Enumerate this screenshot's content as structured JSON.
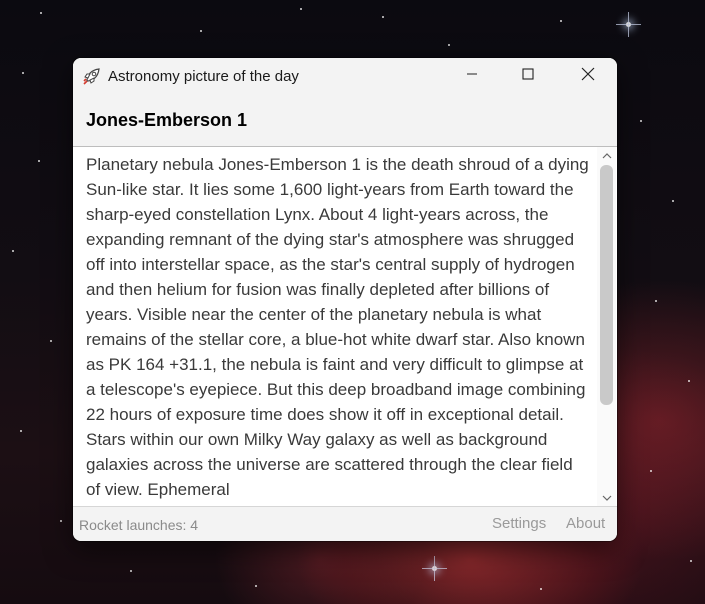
{
  "window": {
    "title": "Astronomy picture of the day",
    "app_icon": "rocket-icon",
    "controls": {
      "minimize_icon": "minimize-icon",
      "maximize_icon": "maximize-icon",
      "close_icon": "close-icon"
    }
  },
  "article": {
    "title": "Jones-Emberson 1",
    "body": "Planetary nebula Jones-Emberson 1 is the death shroud of a dying Sun-like star. It lies some 1,600 light-years from Earth toward the sharp-eyed constellation Lynx. About 4 light-years across, the expanding remnant of the dying star's atmosphere was shrugged off into interstellar space, as the star's central supply of hydrogen and then helium for fusion was finally depleted after billions of years. Visible near the center of the planetary nebula is what remains of the stellar core, a blue-hot white dwarf star.  Also known as PK 164 +31.1, the nebula is faint and very difficult to glimpse at a telescope's eyepiece. But this deep broadband image combining 22 hours of exposure time does show it off in exceptional detail. Stars within our own Milky Way galaxy as well as background galaxies across the universe are scattered through the clear field of view. Ephemeral"
  },
  "scrollbar": {
    "up_icon": "chevron-up-icon",
    "down_icon": "chevron-down-icon"
  },
  "status": {
    "rocket_launches": "Rocket launches: 4",
    "settings_label": "Settings",
    "about_label": "About"
  },
  "colors": {
    "window_bg": "#f3f3f3",
    "text": "#3a3a3a",
    "status_text": "#8a8a8a"
  }
}
